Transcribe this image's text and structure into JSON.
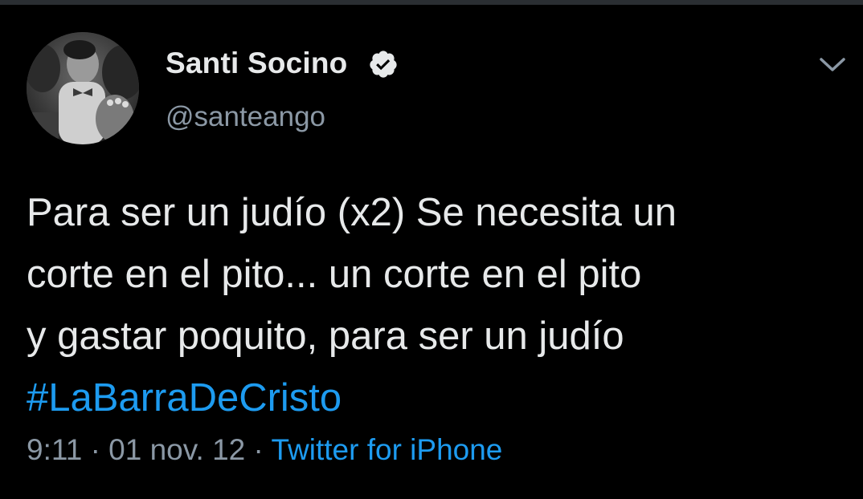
{
  "user": {
    "display_name": "Santi Socino",
    "handle": "@santeango",
    "verified": true
  },
  "tweet": {
    "lines": [
      "Para ser un judío (x2) Se necesita un",
      "corte en el pito... un corte en el pito",
      "y gastar poquito, para ser un judío"
    ],
    "hashtag": "#LaBarraDeCristo"
  },
  "meta": {
    "time": "9:11",
    "separator": "·",
    "date": "01 nov. 12",
    "source": "Twitter for iPhone"
  },
  "icons": {
    "verified": "verified-badge-icon",
    "menu": "chevron-down-icon"
  },
  "colors": {
    "background": "#000000",
    "text": "#e7e9ea",
    "secondary": "#8b98a5",
    "link": "#1d9bf0"
  }
}
